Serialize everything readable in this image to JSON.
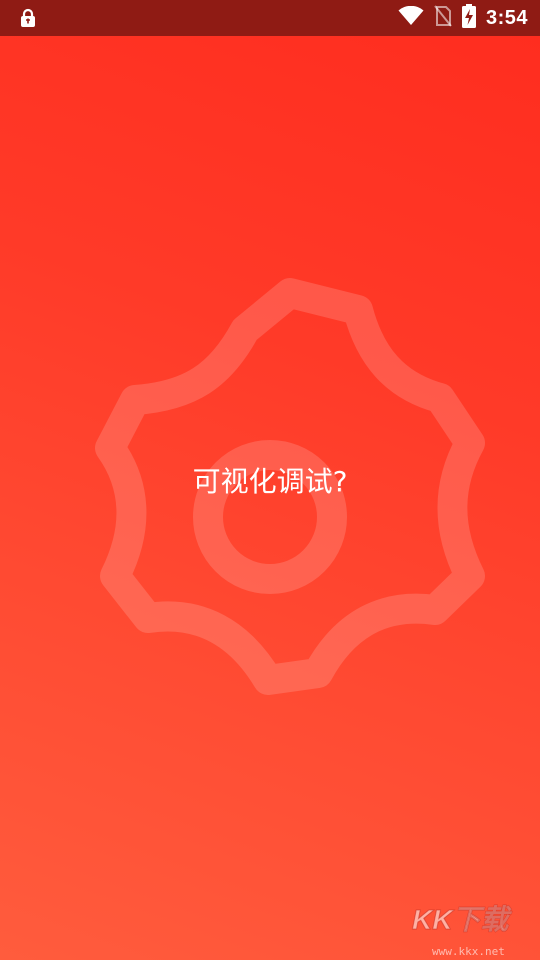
{
  "status_bar": {
    "time": "3:54",
    "icons": [
      "lock-icon",
      "wifi-icon",
      "no-sim-icon",
      "battery-charging-icon"
    ]
  },
  "main": {
    "label": "可视化调试?",
    "icon": "gear-icon"
  },
  "watermark": {
    "logo": "KK下载",
    "url": "www.kkx.net"
  },
  "colors": {
    "status_bar": "#8f1b14",
    "gradient_top": "#ff2d1f",
    "gradient_bottom": "#ff5c3d",
    "text": "#ffffff"
  }
}
